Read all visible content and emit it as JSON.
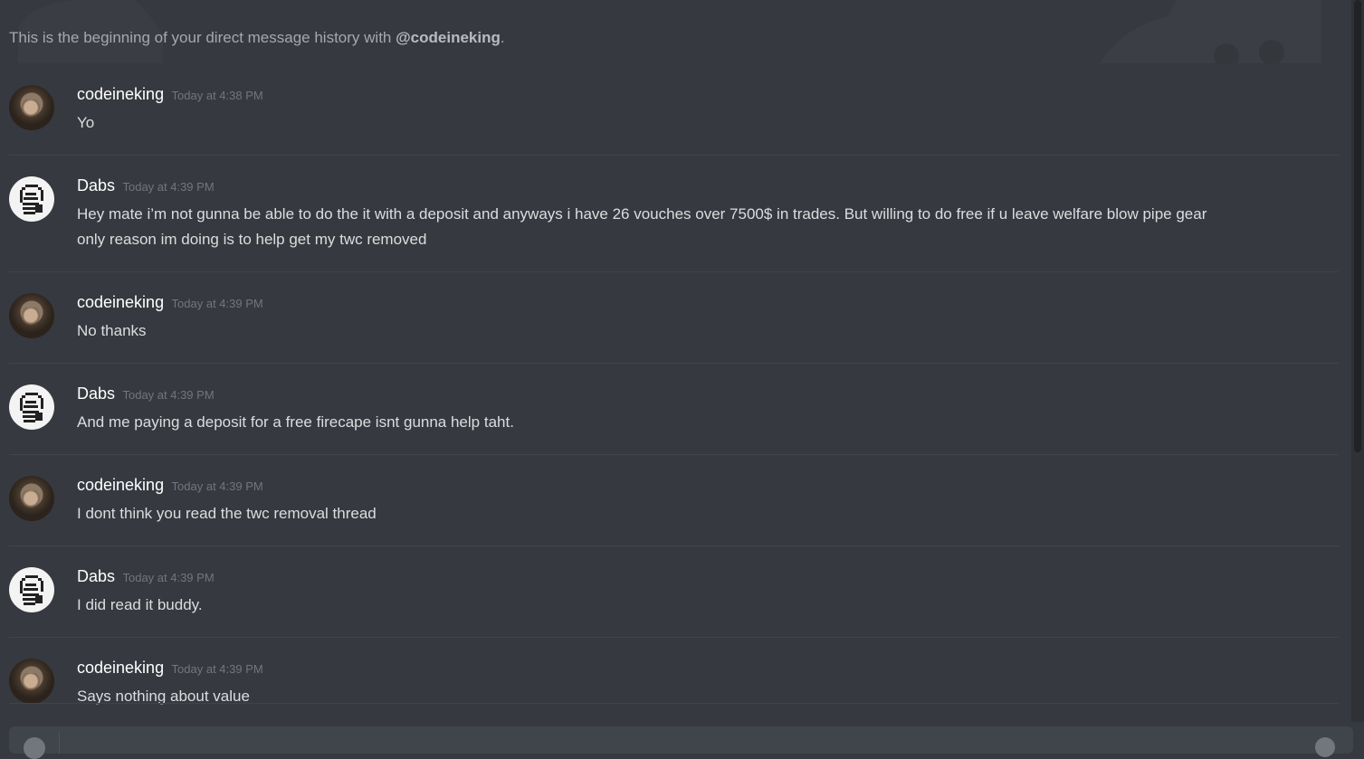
{
  "channel": {
    "intro_text": "This is the beginning of your direct message history with ",
    "intro_user": "@codeineking",
    "intro_end": "."
  },
  "messages": [
    {
      "username": "codeineking",
      "timestamp": "Today at 4:38 PM",
      "lines": [
        "Yo"
      ]
    },
    {
      "username": "Dabs",
      "timestamp": "Today at 4:39 PM",
      "lines": [
        "Hey mate i’m not gunna be able to do the it with a deposit and anyways i have 26 vouches over 7500$ in trades. But willing to do free if u leave welfare blow pipe gear",
        "only reason im doing is to help get my twc removed"
      ]
    },
    {
      "username": "codeineking",
      "timestamp": "Today at 4:39 PM",
      "lines": [
        "No thanks"
      ]
    },
    {
      "username": "Dabs",
      "timestamp": "Today at 4:39 PM",
      "lines": [
        "And me paying a deposit for a free firecape isnt gunna help taht."
      ]
    },
    {
      "username": "codeineking",
      "timestamp": "Today at 4:39 PM",
      "lines": [
        "I dont think you read the twc removal thread"
      ]
    },
    {
      "username": "Dabs",
      "timestamp": "Today at 4:39 PM",
      "lines": [
        "I did read it buddy."
      ]
    },
    {
      "username": "codeineking",
      "timestamp": "Today at 4:39 PM",
      "lines": [
        "Says nothing about value"
      ]
    }
  ],
  "icons": {
    "upload": "plus-circle-icon",
    "emoji": "emoji-icon"
  },
  "colors": {
    "background": "#36393f",
    "username": "#ffffff",
    "timestamp": "#72767d",
    "text": "#dcddde"
  }
}
